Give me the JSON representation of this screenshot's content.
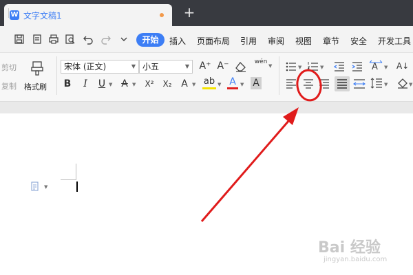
{
  "tab": {
    "app_icon_letter": "W",
    "title": "文字文稿1",
    "new_tab_label": "+"
  },
  "menu": {
    "active": "开始",
    "items": [
      "插入",
      "页面布局",
      "引用",
      "审阅",
      "视图",
      "章节",
      "安全",
      "开发工具"
    ]
  },
  "ribbon": {
    "cut_label": "剪切",
    "copy_label": "复制",
    "format_painter_label": "格式刷",
    "font_name": "宋体 (正文)",
    "font_size": "小五",
    "pinyin_label": "wén",
    "bold": "B",
    "italic": "I",
    "underline": "U",
    "strike": "A",
    "superscript": "X²",
    "subscript": "X₂",
    "effect": "A",
    "highlight": "ab",
    "font_color": "A",
    "char_shade": "A",
    "grow_font": "A⁺",
    "shrink_font": "A⁻",
    "sort_label": "A↓"
  },
  "watermark": {
    "main": "Bai 经验",
    "sub": "jingyan.baidu.com"
  },
  "colors": {
    "accent": "#3d7ef5",
    "annotation": "#e01b1b",
    "highlight_yellow": "#f5e400",
    "font_red": "#e02020"
  }
}
